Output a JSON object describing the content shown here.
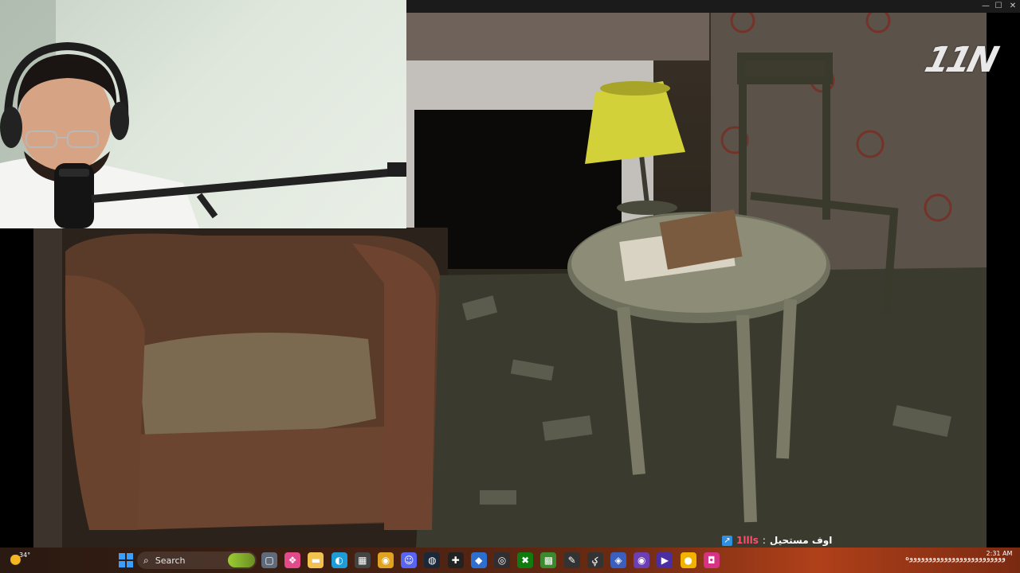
{
  "window": {
    "minimize": "—",
    "maximize": "☐",
    "close": "✕"
  },
  "logo": "11N",
  "chat": {
    "badge_icon": "chat-badge-icon",
    "username": "1llls",
    "separator": ":",
    "message": "اوف مستحيل"
  },
  "taskbar": {
    "weather": {
      "temp": "34°",
      "icon": "sun-icon"
    },
    "search_placeholder": "Search",
    "apps": [
      {
        "name": "file-icon",
        "glyph": "▢",
        "color": "#5f6b7a"
      },
      {
        "name": "colorful-app-icon",
        "glyph": "❖",
        "color": "#e24a8a"
      },
      {
        "name": "folder-icon",
        "glyph": "▬",
        "color": "#f2c14e"
      },
      {
        "name": "edge-icon",
        "glyph": "◐",
        "color": "#1f9bd6"
      },
      {
        "name": "store-icon",
        "glyph": "▦",
        "color": "#444"
      },
      {
        "name": "chrome-icon",
        "glyph": "◉",
        "color": "#e0a221"
      },
      {
        "name": "discord-icon",
        "glyph": "☺",
        "color": "#5865f2"
      },
      {
        "name": "steam-icon",
        "glyph": "◍",
        "color": "#1b2838"
      },
      {
        "name": "capture-icon",
        "glyph": "✚",
        "color": "#222"
      },
      {
        "name": "app-blue-icon",
        "glyph": "◆",
        "color": "#2d6fd1"
      },
      {
        "name": "obs-icon",
        "glyph": "◎",
        "color": "#302e31"
      },
      {
        "name": "xbox-icon",
        "glyph": "✖",
        "color": "#107c10"
      },
      {
        "name": "minecraft-icon",
        "glyph": "▩",
        "color": "#3c8a2e"
      },
      {
        "name": "pen-icon",
        "glyph": "✎",
        "color": "#333"
      },
      {
        "name": "script-icon",
        "glyph": "ؼ",
        "color": "#333"
      },
      {
        "name": "network-icon",
        "glyph": "◈",
        "color": "#3a5fbf"
      },
      {
        "name": "purple-app-icon",
        "glyph": "◉",
        "color": "#6c3fb5"
      },
      {
        "name": "media-icon",
        "glyph": "▶",
        "color": "#4b2ea3"
      },
      {
        "name": "yellow-app-icon",
        "glyph": "●",
        "color": "#f0b400"
      },
      {
        "name": "pink-app-icon",
        "glyph": "◘",
        "color": "#d63384"
      }
    ],
    "ticker": "وووووووووووووووووووووووووه",
    "clock_time": "2:31 AM"
  }
}
